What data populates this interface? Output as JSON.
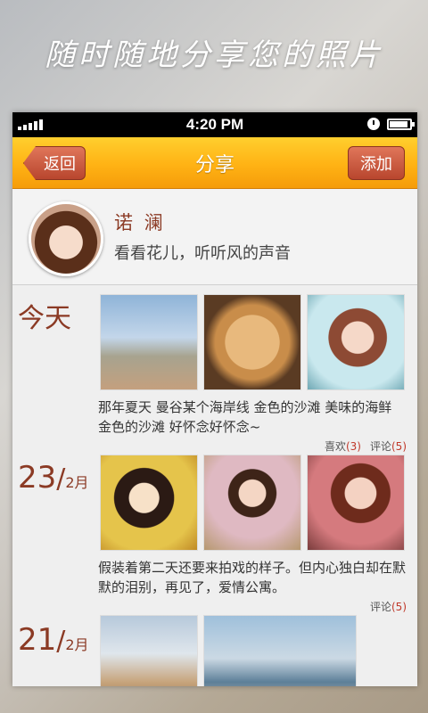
{
  "banner": {
    "text": "随时随地分享您的照片"
  },
  "status_bar": {
    "time": "4:20 PM"
  },
  "nav": {
    "back_label": "返回",
    "title": "分享",
    "add_label": "添加"
  },
  "profile": {
    "name": "诺 澜",
    "bio": "看看花儿，听听风的声音"
  },
  "feed": [
    {
      "date_label": "今天",
      "caption": "那年夏天 曼谷某个海岸线 金色的沙滩 美味的海鲜 金色的沙滩 好怀念好怀念~",
      "likes_label": "喜欢",
      "likes_count": "(3)",
      "comments_label": "评论",
      "comments_count": "(5)"
    },
    {
      "day": "23",
      "slash": "/",
      "month": "2月",
      "caption": "假装着第二天还要来拍戏的样子。但内心独白却在默默的泪别，再见了，爱情公寓。",
      "comments_label": "评论",
      "comments_count": "(5)"
    },
    {
      "day": "21",
      "slash": "/",
      "month": "2月"
    }
  ],
  "colors": {
    "accent": "#ffb214",
    "button": "#c0553a",
    "date_text": "#8b3a24"
  }
}
